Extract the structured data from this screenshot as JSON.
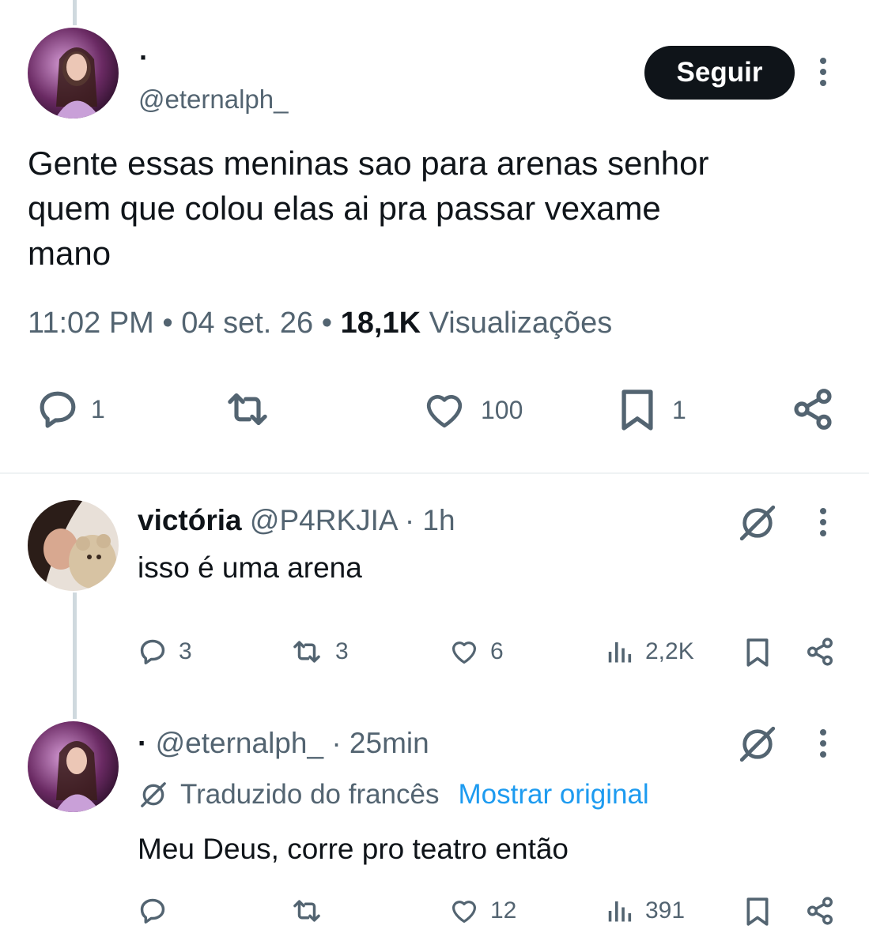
{
  "main_tweet": {
    "display_name": "·",
    "handle": "@eternalph_",
    "follow_label": "Seguir",
    "text_lines": [
      "Gente essas meninas sao para arenas senhor",
      "quem que colou elas ai pra passar vexame",
      "mano"
    ],
    "time": "11:02 PM",
    "sep": "•",
    "date": "04 set. 26",
    "views_count": "18,1K",
    "views_label": "Visualizações",
    "replies": "1",
    "likes": "100",
    "bookmarks": "1"
  },
  "reply1": {
    "display_name": "victória",
    "handle": "@P4RKJIA",
    "time": "· 1h",
    "text": "isso é uma arena",
    "replies": "3",
    "retweets": "3",
    "likes": "6",
    "views": "2,2K"
  },
  "reply2": {
    "display_name": "·",
    "handle": "@eternalph_",
    "time": "· 25min",
    "translated_label": "Traduzido do francês",
    "show_original": "Mostrar original",
    "text": "Meu Deus, corre pro teatro então",
    "likes": "12",
    "views": "391"
  },
  "colors": {
    "text": "#0f1419",
    "secondary": "#536471",
    "link": "#1d9bf0",
    "thread_line": "#cfd9de"
  },
  "icons": [
    "reply-icon",
    "retweet-icon",
    "like-icon",
    "bookmark-icon",
    "share-icon",
    "views-icon",
    "grok-icon",
    "more-icon",
    "translate-icon"
  ]
}
